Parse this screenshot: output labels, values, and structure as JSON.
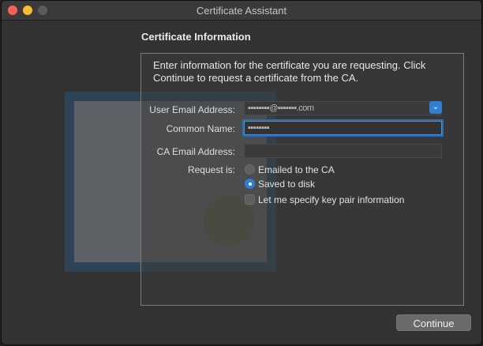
{
  "window": {
    "title": "Certificate Assistant"
  },
  "section": {
    "title": "Certificate Information"
  },
  "intro": {
    "text": "Enter information for the certificate you are requesting. Click Continue to request a certificate from the CA."
  },
  "form": {
    "user_email_label": "User Email Address:",
    "user_email_value": "▪▪▪▪▪▪▪▪@▪▪▪▪▪▪▪.com",
    "common_name_label": "Common Name:",
    "common_name_value": "▪▪▪▪▪▪▪▪",
    "ca_email_label": "CA Email Address:",
    "ca_email_value": "",
    "request_is_label": "Request is:",
    "options": [
      {
        "label": "Emailed to the CA",
        "selected": false
      },
      {
        "label": "Saved to disk",
        "selected": true
      }
    ],
    "keypair_label": "Let me specify key pair information",
    "keypair_checked": false
  },
  "buttons": {
    "continue_label": "Continue"
  },
  "colors": {
    "accent": "#2f7fd6",
    "close": "#fe5f57",
    "minimize": "#febc2e"
  }
}
